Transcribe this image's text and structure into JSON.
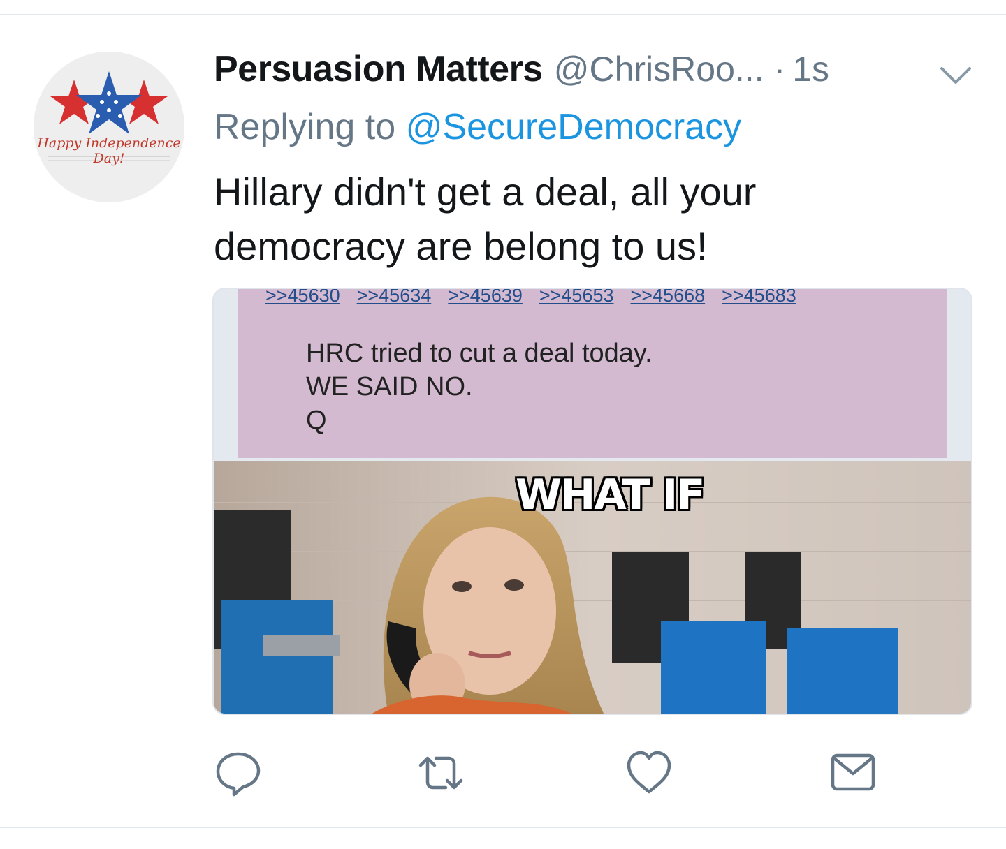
{
  "tweet": {
    "display_name": "Persuasion Matters",
    "handle": "@ChrisRoo...",
    "separator": "·",
    "timestamp": "1s",
    "reply_prefix": "Replying to",
    "reply_mention": "@SecureDemocracy",
    "text_line1": "Hillary didn't get a deal, all your",
    "text_line2": "democracy are belong to us!"
  },
  "avatar": {
    "caption": "Happy Independence Day!"
  },
  "media": {
    "post_refs": [
      ">>45630",
      ">>45634",
      ">>45639",
      ">>45653",
      ">>45668",
      ">>45683"
    ],
    "post_lines": [
      "HRC tried to cut a deal today.",
      "WE SAID NO.",
      "Q"
    ],
    "meme_caption": "WHAT IF",
    "panel_color": "#d4bad0"
  },
  "actions": {
    "reply_icon": "reply-icon",
    "retweet_icon": "retweet-icon",
    "like_icon": "heart-icon",
    "dm_icon": "envelope-icon"
  },
  "colors": {
    "text": "#14171a",
    "secondary": "#657786",
    "link": "#1b95e0"
  }
}
